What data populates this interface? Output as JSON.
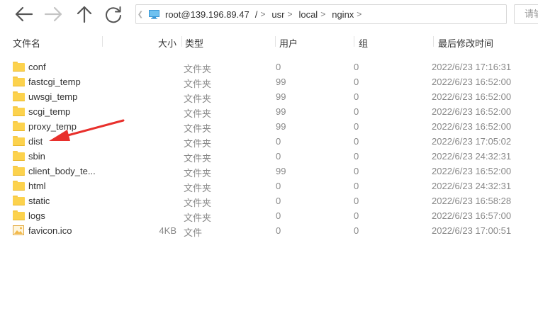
{
  "toolbar": {
    "address": {
      "host_label": "root@139.196.89.47",
      "path": [
        {
          "label": "/",
          "sep": ">"
        },
        {
          "label": "usr",
          "sep": ">"
        },
        {
          "label": "local",
          "sep": ">"
        },
        {
          "label": "nginx",
          "sep": ">"
        }
      ]
    },
    "search": {
      "placeholder": "请输入"
    }
  },
  "columns": {
    "name": "文件名",
    "size": "大小",
    "type": "类型",
    "user": "用户",
    "group": "组",
    "modified": "最后修改时间"
  },
  "files": [
    {
      "name": "conf",
      "icon": "folder-icon",
      "size": "",
      "type": "文件夹",
      "user": "0",
      "group": "0",
      "modified": "2022/6/23 17:16:31"
    },
    {
      "name": "fastcgi_temp",
      "icon": "folder-icon",
      "size": "",
      "type": "文件夹",
      "user": "99",
      "group": "0",
      "modified": "2022/6/23 16:52:00"
    },
    {
      "name": "uwsgi_temp",
      "icon": "folder-icon",
      "size": "",
      "type": "文件夹",
      "user": "99",
      "group": "0",
      "modified": "2022/6/23 16:52:00"
    },
    {
      "name": "scgi_temp",
      "icon": "folder-icon",
      "size": "",
      "type": "文件夹",
      "user": "99",
      "group": "0",
      "modified": "2022/6/23 16:52:00"
    },
    {
      "name": "proxy_temp",
      "icon": "folder-icon",
      "size": "",
      "type": "文件夹",
      "user": "99",
      "group": "0",
      "modified": "2022/6/23 16:52:00"
    },
    {
      "name": "dist",
      "icon": "folder-icon",
      "size": "",
      "type": "文件夹",
      "user": "0",
      "group": "0",
      "modified": "2022/6/23 17:05:02"
    },
    {
      "name": "sbin",
      "icon": "folder-icon",
      "size": "",
      "type": "文件夹",
      "user": "0",
      "group": "0",
      "modified": "2022/6/23 24:32:31"
    },
    {
      "name": "client_body_te...",
      "icon": "folder-icon",
      "size": "",
      "type": "文件夹",
      "user": "99",
      "group": "0",
      "modified": "2022/6/23 16:52:00"
    },
    {
      "name": "html",
      "icon": "folder-icon",
      "size": "",
      "type": "文件夹",
      "user": "0",
      "group": "0",
      "modified": "2022/6/23 24:32:31"
    },
    {
      "name": "static",
      "icon": "folder-icon",
      "size": "",
      "type": "文件夹",
      "user": "0",
      "group": "0",
      "modified": "2022/6/23 16:58:28"
    },
    {
      "name": "logs",
      "icon": "folder-icon",
      "size": "",
      "type": "文件夹",
      "user": "0",
      "group": "0",
      "modified": "2022/6/23 16:57:00"
    },
    {
      "name": "favicon.ico",
      "icon": "image-file-icon",
      "size": "4KB",
      "type": "文件",
      "user": "0",
      "group": "0",
      "modified": "2022/6/23 17:00:51"
    }
  ],
  "annotation": {
    "color": "#e8302c",
    "points_to": "dist"
  }
}
